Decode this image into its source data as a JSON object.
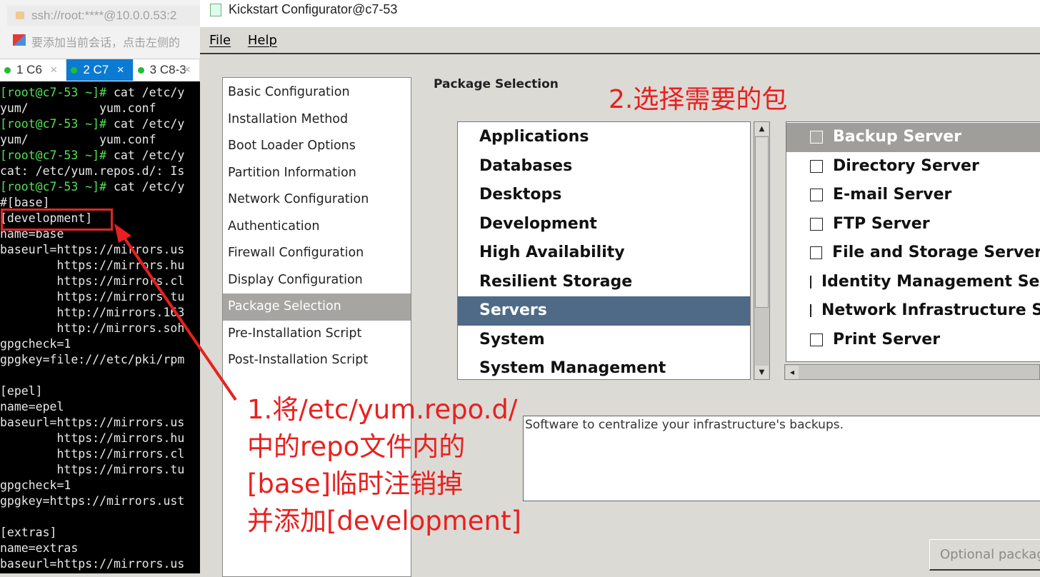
{
  "terminal": {
    "address": "ssh://root:****@10.0.0.53:2",
    "hint": "要添加当前会话，点击左侧的",
    "tabs": [
      {
        "label": "1 C6",
        "active": false
      },
      {
        "label": "2 C7",
        "active": true
      },
      {
        "label": "3 C8-3",
        "active": false
      }
    ],
    "lines": [
      {
        "prompt": "[root@c7-53 ~]#",
        "text": " cat /etc/y"
      },
      {
        "prompt": "",
        "text": "yum/          yum.conf"
      },
      {
        "prompt": "[root@c7-53 ~]#",
        "text": " cat /etc/y"
      },
      {
        "prompt": "",
        "text": "yum/          yum.conf"
      },
      {
        "prompt": "[root@c7-53 ~]#",
        "text": " cat /etc/y"
      },
      {
        "prompt": "",
        "text": "cat: /etc/yum.repos.d/: Is"
      },
      {
        "prompt": "[root@c7-53 ~]#",
        "text": " cat /etc/y"
      },
      {
        "prompt": "",
        "text": "#[base]"
      },
      {
        "prompt": "",
        "text": "[development]"
      },
      {
        "prompt": "",
        "text": "name=base"
      },
      {
        "prompt": "",
        "text": "baseurl=https://mirrors.us"
      },
      {
        "prompt": "",
        "text": "        https://mirrors.hu"
      },
      {
        "prompt": "",
        "text": "        https://mirrors.cl"
      },
      {
        "prompt": "",
        "text": "        https://mirrors.tu"
      },
      {
        "prompt": "",
        "text": "        http://mirrors.163"
      },
      {
        "prompt": "",
        "text": "        http://mirrors.soh"
      },
      {
        "prompt": "",
        "text": "gpgcheck=1"
      },
      {
        "prompt": "",
        "text": "gpgkey=file:///etc/pki/rpm"
      },
      {
        "prompt": "",
        "text": ""
      },
      {
        "prompt": "",
        "text": "[epel]"
      },
      {
        "prompt": "",
        "text": "name=epel"
      },
      {
        "prompt": "",
        "text": "baseurl=https://mirrors.us"
      },
      {
        "prompt": "",
        "text": "        https://mirrors.hu"
      },
      {
        "prompt": "",
        "text": "        https://mirrors.cl"
      },
      {
        "prompt": "",
        "text": "        https://mirrors.tu"
      },
      {
        "prompt": "",
        "text": "gpgcheck=1"
      },
      {
        "prompt": "",
        "text": "gpgkey=https://mirrors.ust"
      },
      {
        "prompt": "",
        "text": ""
      },
      {
        "prompt": "",
        "text": "[extras]"
      },
      {
        "prompt": "",
        "text": "name=extras"
      },
      {
        "prompt": "",
        "text": "baseurl=https://mirrors.us"
      }
    ]
  },
  "app": {
    "title": "Kickstart Configurator@c7-53",
    "menu": [
      "File",
      "Help"
    ],
    "nav": [
      "Basic Configuration",
      "Installation Method",
      "Boot Loader Options",
      "Partition Information",
      "Network Configuration",
      "Authentication",
      "Firewall Configuration",
      "Display Configuration",
      "Package Selection",
      "Pre-Installation Script",
      "Post-Installation Script"
    ],
    "nav_selected": 8,
    "heading": "Package Selection",
    "categories": [
      "Applications",
      "Databases",
      "Desktops",
      "Development",
      "High Availability",
      "Resilient Storage",
      "Servers",
      "System",
      "System Management"
    ],
    "category_selected": 6,
    "groups": [
      {
        "label": "Backup Server",
        "checked": false
      },
      {
        "label": "Directory Server",
        "checked": false
      },
      {
        "label": "E-mail Server",
        "checked": false
      },
      {
        "label": "FTP Server",
        "checked": false
      },
      {
        "label": "File and Storage Server",
        "checked": false
      },
      {
        "label": "Identity Management Server",
        "checked": false
      },
      {
        "label": "Network Infrastructure Server",
        "checked": false
      },
      {
        "label": "Print Server",
        "checked": false
      }
    ],
    "group_selected": 0,
    "description": "Software to centralize your infrastructure's backups.",
    "optional_button": "Optional packages"
  },
  "annotations": {
    "step1": "1.将/etc/yum.repo.d/\n中的repo文件内的\n[base]临时注销掉\n并添加[development]",
    "step2": "2.选择需要的包",
    "color": "#e8201f"
  }
}
